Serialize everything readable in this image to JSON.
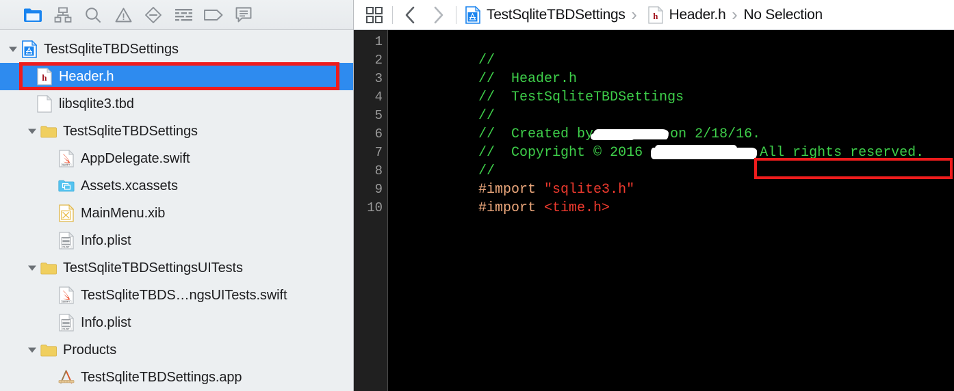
{
  "navigator": {
    "toolbar": {
      "icons": [
        {
          "name": "folder-icon",
          "label": "Show the Project navigator",
          "active": true
        },
        {
          "name": "source-control-icon",
          "label": "Show the Source Control navigator",
          "active": false
        },
        {
          "name": "search-icon",
          "label": "Show the Find navigator",
          "active": false
        },
        {
          "name": "warning-triangle-icon",
          "label": "Show the Issue navigator",
          "active": false
        },
        {
          "name": "test-diamond-icon",
          "label": "Show the Test navigator",
          "active": false
        },
        {
          "name": "debug-list-icon",
          "label": "Show the Debug navigator",
          "active": false
        },
        {
          "name": "breakpoint-tag-icon",
          "label": "Show the Breakpoint navigator",
          "active": false
        },
        {
          "name": "report-message-icon",
          "label": "Show the Report navigator",
          "active": false
        }
      ]
    },
    "tree": [
      {
        "label": "TestSqliteTBDSettings",
        "icon": "xcodeproj-icon",
        "indent": 0,
        "twisty": "down",
        "selected": false
      },
      {
        "label": "Header.h",
        "icon": "h-file-icon",
        "indent": 1,
        "twisty": "none",
        "selected": true
      },
      {
        "label": "libsqlite3.tbd",
        "icon": "blank-file-icon",
        "indent": 1,
        "twisty": "none",
        "selected": false
      },
      {
        "label": "TestSqliteTBDSettings",
        "icon": "folder-icon",
        "indent": 1,
        "twisty": "down",
        "selected": false
      },
      {
        "label": "AppDelegate.swift",
        "icon": "swift-file-icon",
        "indent": 2,
        "twisty": "none",
        "selected": false
      },
      {
        "label": "Assets.xcassets",
        "icon": "xcassets-icon",
        "indent": 2,
        "twisty": "none",
        "selected": false
      },
      {
        "label": "MainMenu.xib",
        "icon": "xib-file-icon",
        "indent": 2,
        "twisty": "none",
        "selected": false
      },
      {
        "label": "Info.plist",
        "icon": "plist-file-icon",
        "indent": 2,
        "twisty": "none",
        "selected": false
      },
      {
        "label": "TestSqliteTBDSettingsUITests",
        "icon": "folder-icon",
        "indent": 1,
        "twisty": "down",
        "selected": false
      },
      {
        "label": "TestSqliteTBDS…ngsUITests.swift",
        "icon": "swift-file-icon",
        "indent": 2,
        "twisty": "none",
        "selected": false
      },
      {
        "label": "Info.plist",
        "icon": "plist-file-icon",
        "indent": 2,
        "twisty": "none",
        "selected": false
      },
      {
        "label": "Products",
        "icon": "folder-icon",
        "indent": 1,
        "twisty": "down",
        "selected": false
      },
      {
        "label": "TestSqliteTBDSettings.app",
        "icon": "app-product-icon",
        "indent": 2,
        "twisty": "none",
        "selected": false
      }
    ]
  },
  "editor": {
    "jumpbar": {
      "related_items_icon": "related-items-icon",
      "back_icon": "back-chevron-icon",
      "forward_icon": "forward-chevron-icon",
      "crumbs": [
        {
          "text": "TestSqliteTBDSettings",
          "icon": "xcodeproj-icon"
        },
        {
          "text": "Header.h",
          "icon": "h-file-icon"
        },
        {
          "text": "No Selection",
          "icon": "none"
        }
      ],
      "chevron": "›"
    },
    "gutter_lines": [
      "1",
      "2",
      "3",
      "4",
      "5",
      "6",
      "7",
      "8",
      "9",
      "10"
    ],
    "code_lines": [
      {
        "n": 1,
        "segments": [
          {
            "t": "comment",
            "s": "//"
          }
        ]
      },
      {
        "n": 2,
        "segments": [
          {
            "t": "comment",
            "s": "//  Header.h"
          }
        ]
      },
      {
        "n": 3,
        "segments": [
          {
            "t": "comment",
            "s": "//  TestSqliteTBDSettings"
          }
        ]
      },
      {
        "n": 4,
        "segments": [
          {
            "t": "comment",
            "s": "//"
          }
        ]
      },
      {
        "n": 5,
        "segments": [
          {
            "t": "comment",
            "s": "//  Created by"
          },
          {
            "t": "redact",
            "s": "r1"
          },
          {
            "t": "comment",
            "s": "on 2/18/16."
          }
        ]
      },
      {
        "n": 6,
        "segments": [
          {
            "t": "comment",
            "s": "//  Copyright © 2016 "
          },
          {
            "t": "redact",
            "s": "r2"
          },
          {
            "t": "comment",
            "s": "All rights reserved."
          }
        ]
      },
      {
        "n": 7,
        "segments": [
          {
            "t": "comment",
            "s": "//"
          }
        ]
      },
      {
        "n": 8,
        "segments": [
          {
            "t": "pre",
            "s": "#import "
          },
          {
            "t": "str",
            "s": "\"sqlite3.h\""
          }
        ]
      },
      {
        "n": 9,
        "segments": [
          {
            "t": "pre",
            "s": "#import "
          },
          {
            "t": "str",
            "s": "<time.h>"
          }
        ]
      },
      {
        "n": 10,
        "segments": []
      }
    ]
  },
  "annotations": {
    "sidebar_box_color": "#ee1c1c",
    "code_box_color": "#ee1c1c",
    "selection_color": "#2e8bef",
    "comment_color": "#3ecf4a",
    "preprocessor_color": "#eda87c",
    "string_color": "#ef3a2e"
  }
}
